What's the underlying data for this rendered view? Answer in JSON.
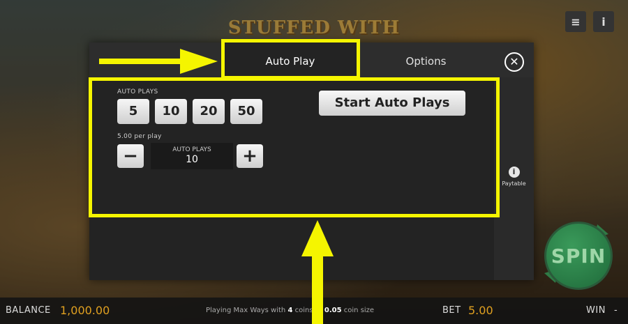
{
  "game": {
    "logo_text": "STUFFED WITH WINS",
    "menu_icon": "hamburger-icon",
    "info_icon": "info-icon",
    "spin_label": "SPIN"
  },
  "modal": {
    "tabs": [
      {
        "label": "Auto Play",
        "active": true
      },
      {
        "label": "Options",
        "active": false
      }
    ],
    "close_icon": "close-icon",
    "auto_plays_label": "AUTO PLAYS",
    "quick_values": [
      "5",
      "10",
      "20",
      "50"
    ],
    "per_play_label": "5.00 per play",
    "stepper": {
      "minus": "−",
      "plus": "+",
      "label": "AUTO PLAYS",
      "value": "10"
    },
    "start_button": "Start Auto Plays",
    "paytable_label": "Paytable"
  },
  "bottom_bar": {
    "balance_label": "BALANCE",
    "balance_value": "1,000.00",
    "playing_prefix": "Playing Max Ways with",
    "coins": "4",
    "coins_suffix": "coins @",
    "coin_size": "0.05",
    "coin_size_suffix": "coin size",
    "bet_label": "BET",
    "bet_value": "5.00",
    "win_label": "WIN",
    "win_value": "-"
  },
  "colors": {
    "highlight": "#f5f500",
    "accent_value": "#e0a020",
    "spin_green": "#2f8a4a"
  }
}
